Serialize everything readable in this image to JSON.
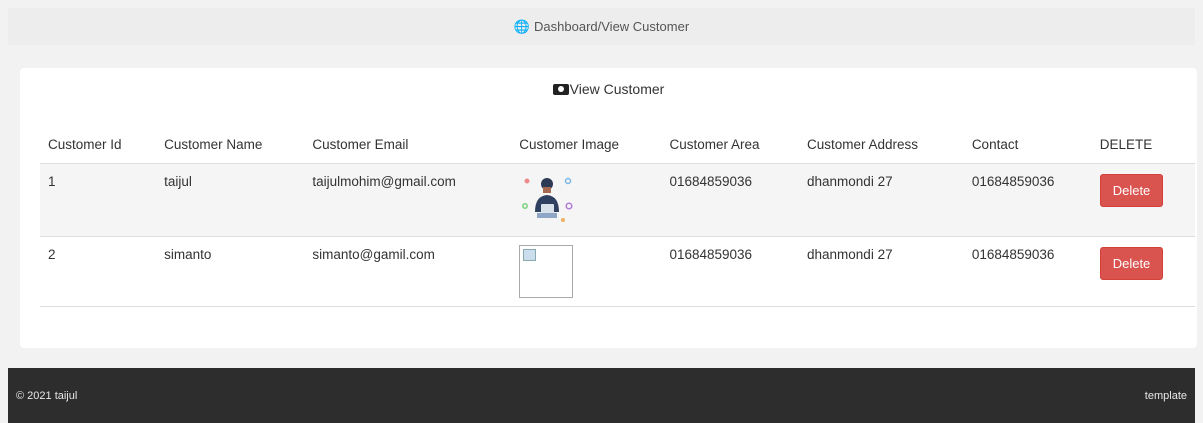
{
  "topbar": {
    "icon": "globe-icon",
    "breadcrumb": "Dashboard/View Customer"
  },
  "card": {
    "icon": "camera-icon",
    "title": "View Customer"
  },
  "table": {
    "headers": [
      "Customer Id",
      "Customer Name",
      "Customer Email",
      "Customer Image",
      "Customer Area",
      "Customer Address",
      "Contact",
      "DELETE"
    ],
    "rows": [
      {
        "id": "1",
        "name": "taijul",
        "email": "taijulmohim@gmail.com",
        "image": "avatar-illustration",
        "area": "01684859036",
        "address": "dhanmondi 27",
        "contact": "01684859036",
        "delete": "Delete"
      },
      {
        "id": "2",
        "name": "simanto",
        "email": "simanto@gamil.com",
        "image": "broken-image",
        "area": "01684859036",
        "address": "dhanmondi 27",
        "contact": "01684859036",
        "delete": "Delete"
      }
    ]
  },
  "footer": {
    "copyright": "© 2021 taijul",
    "right": "template"
  },
  "colors": {
    "delete_button": "#d9534f",
    "footer_bg": "#2d2d2d",
    "page_bg": "#f2f2f2"
  }
}
